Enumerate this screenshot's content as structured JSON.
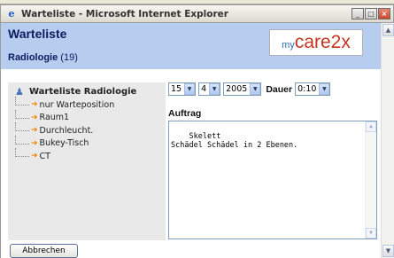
{
  "window": {
    "title": "Warteliste - Microsoft Internet Explorer",
    "min_glyph": "_",
    "max_glyph": "□",
    "close_glyph": "×"
  },
  "header": {
    "title": "Warteliste",
    "subtitle": "Radiologie",
    "count": "(19)",
    "logo_prefix": "my",
    "logo_main": "care2x"
  },
  "tree": {
    "root_label": "Warteliste Radiologie",
    "items": [
      {
        "label": "nur Warteposition"
      },
      {
        "label": "Raum1"
      },
      {
        "label": "Durchleucht."
      },
      {
        "label": "Bukey-Tisch"
      },
      {
        "label": "CT"
      }
    ]
  },
  "controls": {
    "day": "15",
    "month": "4",
    "year": "2005",
    "dauer_label": "Dauer",
    "dauer_value": "0:10"
  },
  "auftrag": {
    "label": "Auftrag",
    "text": "Skelett\nSchädel Schädel in 2 Ebenen."
  },
  "buttons": {
    "cancel": "Abbrechen"
  },
  "icons": {
    "ie": "internet-explorer-icon",
    "person": "person-icon",
    "arrow": "arrow-right-icon"
  },
  "colors": {
    "header_bg": "#b6cdf0",
    "title_color": "#0b1d5e",
    "logo_my": "#2c6db0",
    "logo_care": "#c4341f",
    "arrow": "#f08a00"
  }
}
